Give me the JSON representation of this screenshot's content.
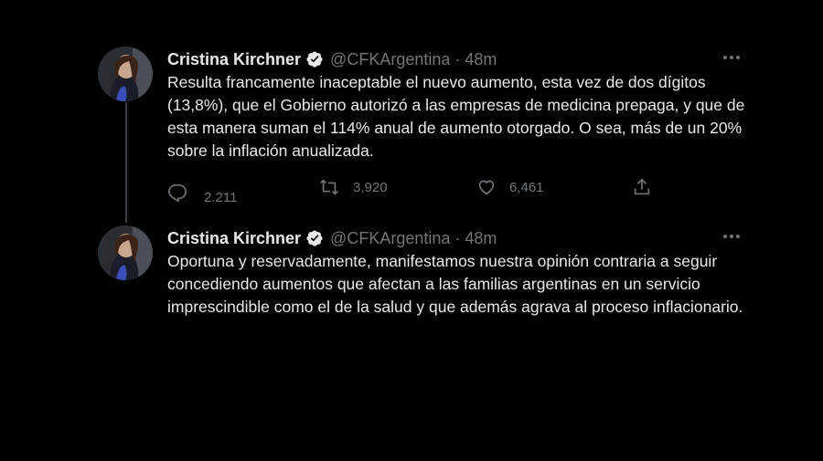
{
  "tweets": [
    {
      "author": "Cristina Kirchner",
      "handle": "@CFKArgentina",
      "separator": "·",
      "time": "48m",
      "text": "Resulta francamente inaceptable el nuevo aumento, esta vez de dos dígitos (13,8%), que el Gobierno autorizó a las empresas de medicina prepaga, y que de esta manera suman el 114% anual de aumento otorgado. O sea, más de un 20% sobre la inflación anualizada.",
      "replies": "2.211",
      "retweets": "3,920",
      "likes": "6,461"
    },
    {
      "author": "Cristina Kirchner",
      "handle": "@CFKArgentina",
      "separator": "·",
      "time": "48m",
      "text": "Oportuna y reservadamente, manifestamos nuestra opinión contraria a seguir concediendo aumentos que afectan a las familias argentinas en un servicio imprescindible como el de la salud y que además agrava al proceso inflacionario."
    }
  ],
  "icons": [
    "avatar",
    "verified-badge-icon",
    "more-icon",
    "reply-icon",
    "retweet-icon",
    "like-icon",
    "share-icon"
  ],
  "colors": {
    "background": "#000000",
    "text": "#e7e9ea",
    "secondary": "#71767b",
    "thread_line": "#3a3f44"
  }
}
